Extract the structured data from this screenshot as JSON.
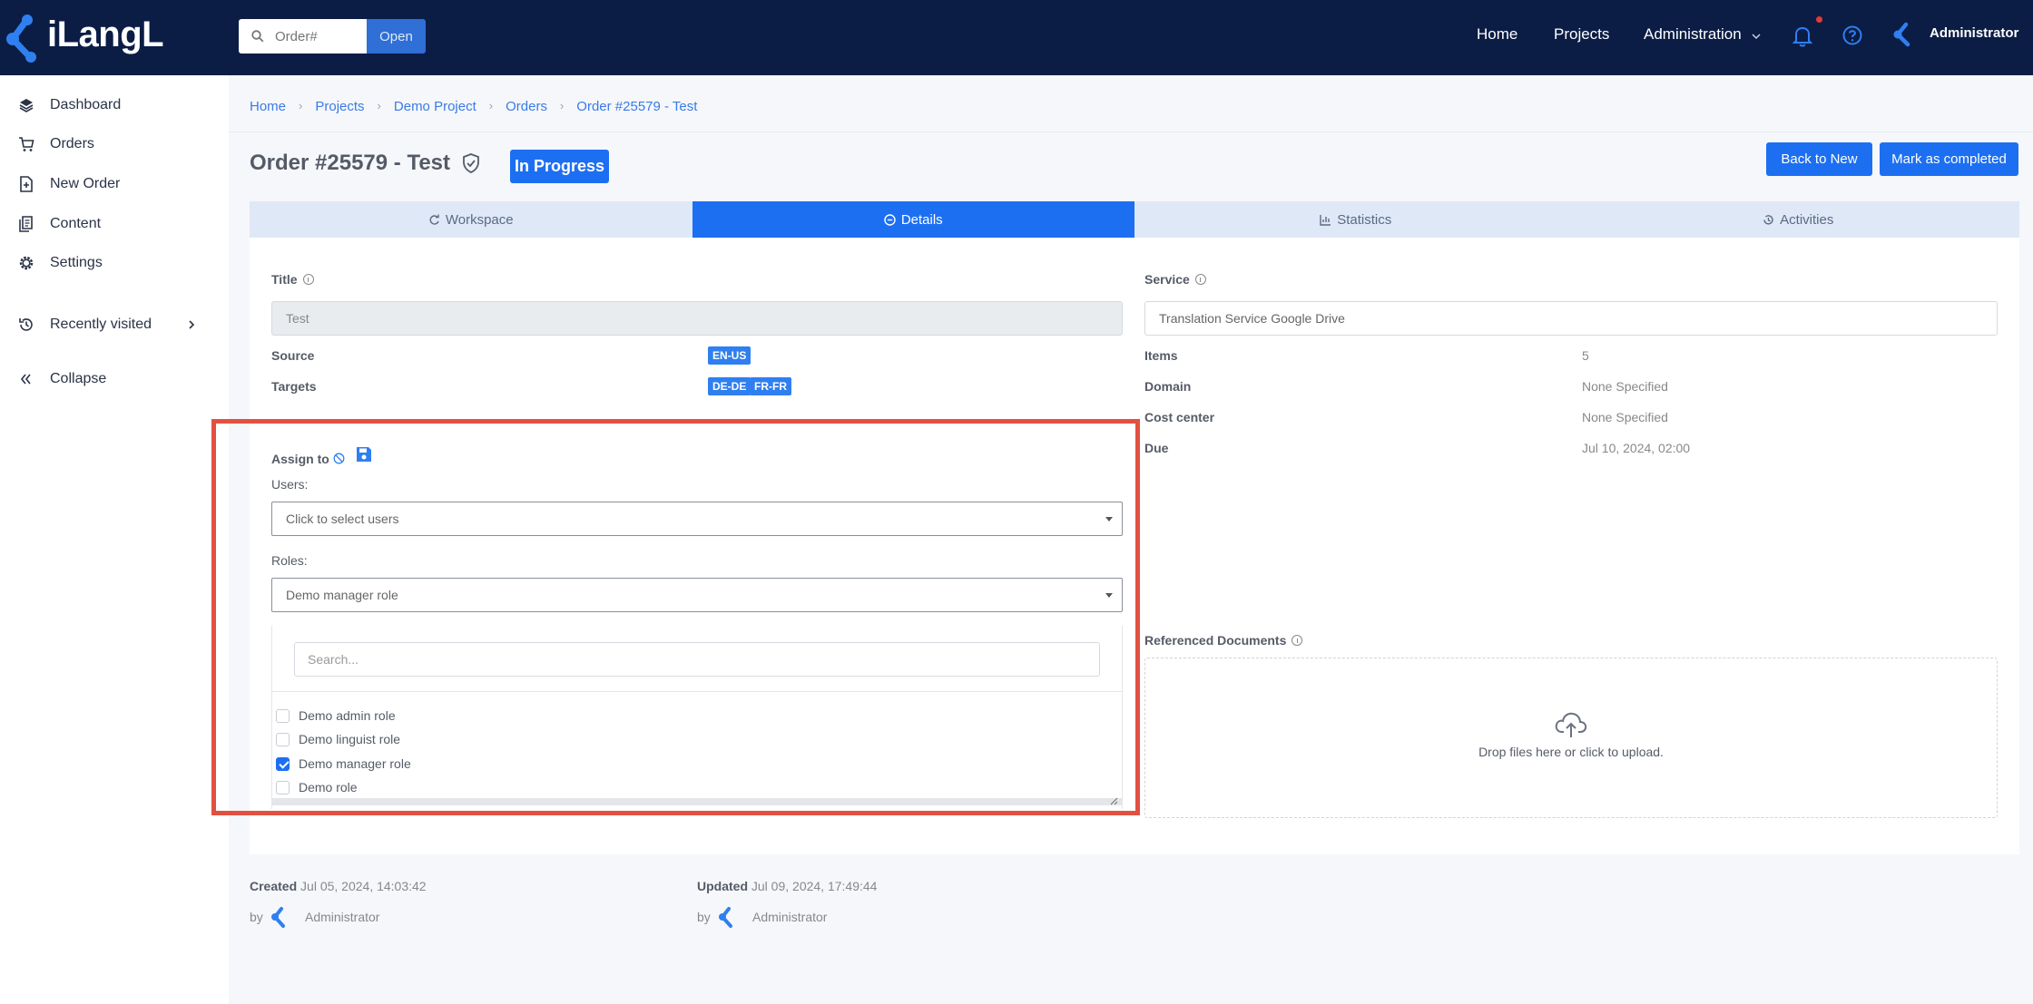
{
  "app": {
    "name": "iLangL"
  },
  "topbar": {
    "search_placeholder": "Order#",
    "search_button": "Open",
    "nav": [
      "Home",
      "Projects",
      "Administration"
    ],
    "user_name": "Administrator"
  },
  "sidebar": {
    "items": [
      {
        "label": "Dashboard",
        "icon": "layers-icon"
      },
      {
        "label": "Orders",
        "icon": "cart-icon"
      },
      {
        "label": "New Order",
        "icon": "new-file-icon"
      },
      {
        "label": "Content",
        "icon": "documents-icon"
      },
      {
        "label": "Settings",
        "icon": "gear-icon"
      },
      {
        "label": "Recently visited",
        "icon": "history-icon"
      },
      {
        "label": "Collapse",
        "icon": "double-chevron-left-icon"
      }
    ]
  },
  "breadcrumb": [
    "Home",
    "Projects",
    "Demo Project",
    "Orders",
    "Order #25579 - Test"
  ],
  "order": {
    "title": "Order #25579 - Test",
    "status": "In Progress",
    "back_button": "Back to New",
    "complete_button": "Mark as completed"
  },
  "tabs": [
    "Workspace",
    "Details",
    "Statistics",
    "Activities"
  ],
  "details": {
    "title_label": "Title",
    "title_value": "Test",
    "service_label": "Service",
    "service_value": "Translation Service Google Drive",
    "source_label": "Source",
    "source_tags": [
      "EN-US"
    ],
    "targets_label": "Targets",
    "target_tags": [
      "DE-DE",
      "FR-FR"
    ],
    "items_label": "Items",
    "items_value": "5",
    "domain_label": "Domain",
    "domain_value": "None Specified",
    "cost_center_label": "Cost center",
    "cost_center_value": "None Specified",
    "due_label": "Due",
    "due_value": "Jul 10, 2024, 02:00"
  },
  "assign": {
    "label": "Assign to",
    "users_label": "Users:",
    "users_placeholder": "Click to select users",
    "roles_label": "Roles:",
    "roles_value": "Demo manager role",
    "search_placeholder": "Search...",
    "options": [
      {
        "label": "Demo admin role",
        "checked": false
      },
      {
        "label": "Demo linguist role",
        "checked": false
      },
      {
        "label": "Demo manager role",
        "checked": true
      },
      {
        "label": "Demo role",
        "checked": false
      }
    ]
  },
  "documents": {
    "label": "Referenced Documents",
    "drop_text": "Drop files here or click to upload."
  },
  "footer": {
    "created_label": "Created",
    "created_value": "Jul 05, 2024, 14:03:42",
    "updated_label": "Updated",
    "updated_value": "Jul 09, 2024, 17:49:44",
    "by_label": "by",
    "created_by": "Administrator",
    "updated_by": "Administrator"
  },
  "colors": {
    "topbar": "#0b1d45",
    "accent": "#1d6ff2",
    "highlight": "#e25140"
  }
}
